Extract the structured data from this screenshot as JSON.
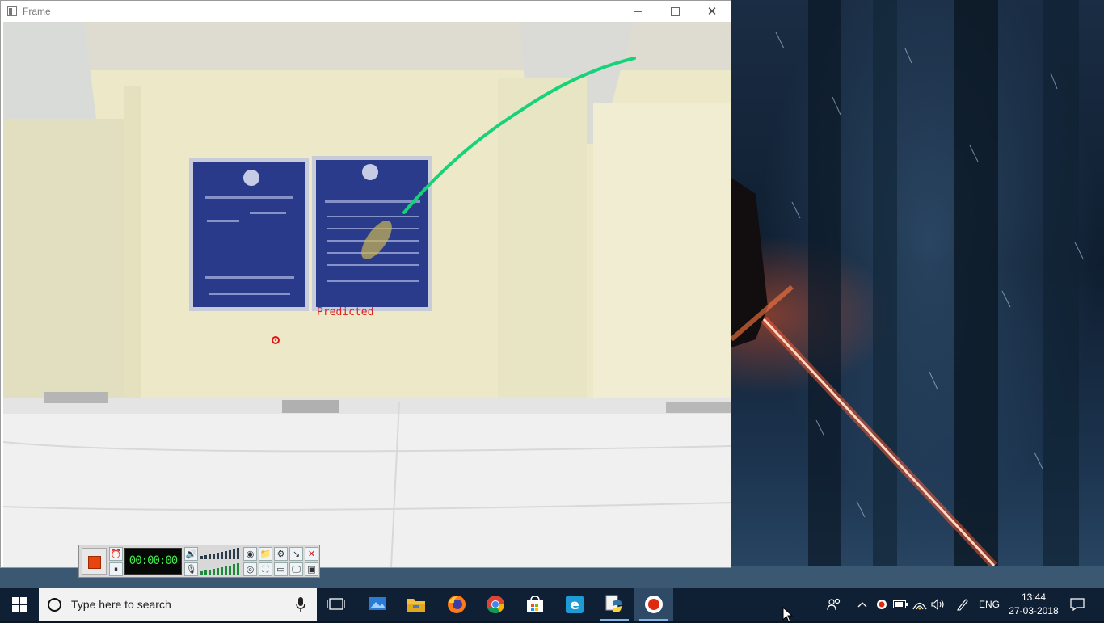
{
  "window": {
    "title": "Frame",
    "buttons": {
      "minimize": "minimize",
      "maximize": "maximize",
      "close": "✕"
    }
  },
  "camera": {
    "label": "Predicted"
  },
  "recorder": {
    "timer": "00:00:00",
    "accent": "#e8440f"
  },
  "taskbar": {
    "search_placeholder": "Type here to search",
    "language": "ENG",
    "time": "13:44",
    "date": "27-03-2018",
    "apps": [
      "task-view-icon",
      "photos-icon",
      "file-explorer-icon",
      "firefox-icon",
      "chrome-icon",
      "store-icon",
      "edge-icon",
      "python-icon",
      "screen-recorder-icon"
    ],
    "accent": "#7fb4e6"
  },
  "colors": {
    "trajectory": "#16d37a",
    "prediction": "#e01515",
    "taskbar_bg": "#0f2035"
  }
}
